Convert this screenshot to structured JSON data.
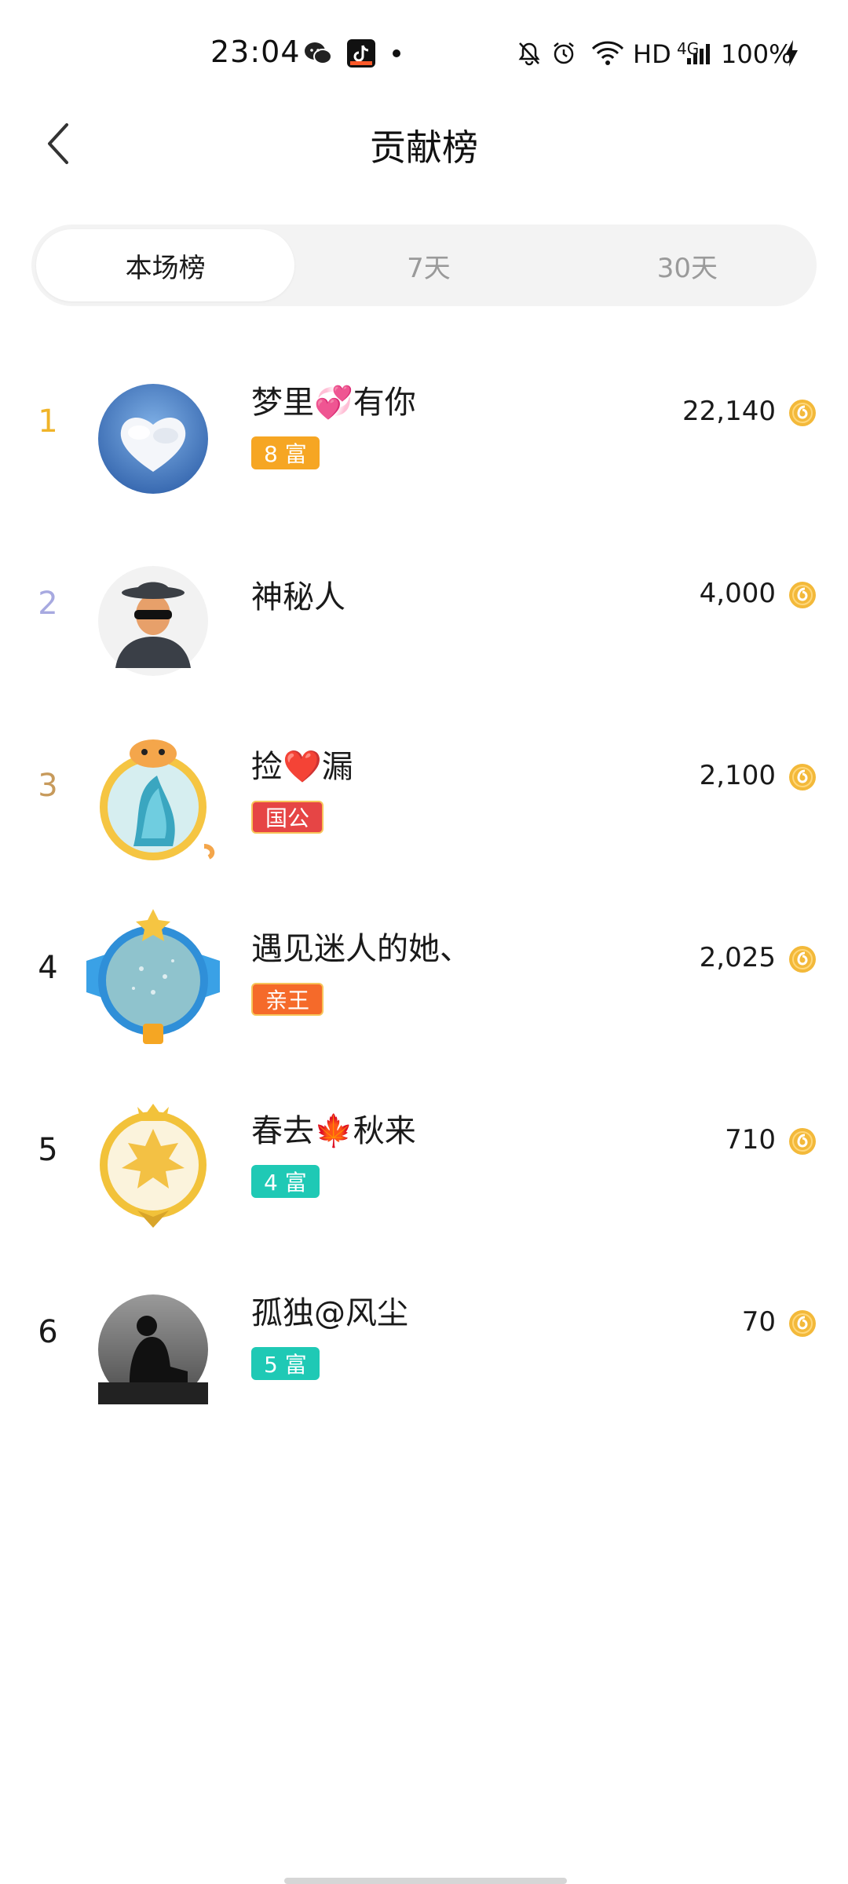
{
  "status_bar": {
    "time": "23:04",
    "network_label": "HD",
    "signal_label": "4G",
    "battery": "100%"
  },
  "header": {
    "title": "贡献榜"
  },
  "tabs": [
    {
      "label": "本场榜",
      "active": true
    },
    {
      "label": "7天",
      "active": false
    },
    {
      "label": "30天",
      "active": false
    }
  ],
  "ranking": [
    {
      "rank": "1",
      "name": "梦里💞有你",
      "badge": "8 富",
      "badge_type": "wealth",
      "score": "22,140"
    },
    {
      "rank": "2",
      "name": "神秘人",
      "badge": "",
      "badge_type": "none",
      "score": "4,000"
    },
    {
      "rank": "3",
      "name": "捡❤️漏",
      "badge": "国公",
      "badge_type": "noble-red",
      "score": "2,100"
    },
    {
      "rank": "4",
      "name": "遇见迷人的她、",
      "badge": "亲王",
      "badge_type": "noble-orange",
      "score": "2,025"
    },
    {
      "rank": "5",
      "name": "春去🍁秋来",
      "badge": "4 富",
      "badge_type": "wealth-teal",
      "score": "710"
    },
    {
      "rank": "6",
      "name": "孤独@风尘",
      "badge": "5 富",
      "badge_type": "wealth-teal",
      "score": "70"
    }
  ],
  "colors": {
    "rank1": "#f0b429",
    "rank2": "#a7a9e0",
    "rank3": "#c79a5b",
    "rank_default": "#1a1a1a",
    "coin": "#f3b93a",
    "wealth_orange": "#f6a623",
    "wealth_teal": "#1fc9b5",
    "noble_red": "#e64545",
    "noble_orange": "#f56a2a"
  },
  "icons": {
    "back": "chevron-left-icon",
    "coin": "coin-icon"
  }
}
